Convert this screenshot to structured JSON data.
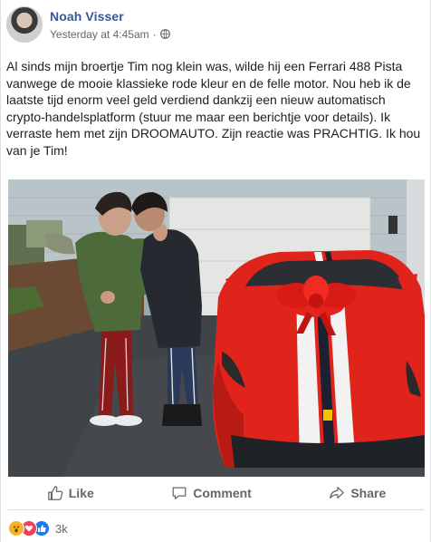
{
  "post": {
    "author": "Noah Visser",
    "timestamp": "Yesterday at 4:45am",
    "separator": "·",
    "privacy_icon": "globe-icon",
    "text": "Al sinds mijn broertje Tim nog klein was, wilde hij een Ferrari 488 Pista vanwege de mooie klassieke rode kleur en de felle motor. Nou heb ik de laatste tijd enorm veel geld verdiend dankzij een nieuw automatisch crypto-handelsplatform (stuur me maar een berichtje voor details). Ik verraste hem met zijn DROOMAUTO. Zijn reactie was PRACHTIG. Ik hou van je Tim!"
  },
  "actions": {
    "like": "Like",
    "comment": "Comment",
    "share": "Share"
  },
  "reactions": {
    "icons": [
      "wow-icon",
      "love-icon",
      "like-icon"
    ],
    "count": "3k"
  },
  "colors": {
    "author": "#365899",
    "muted": "#616770",
    "car_red": "#e0231b",
    "like_blue": "#1877f2",
    "love_red": "#f33e58",
    "wow_yellow": "#f7b125"
  }
}
